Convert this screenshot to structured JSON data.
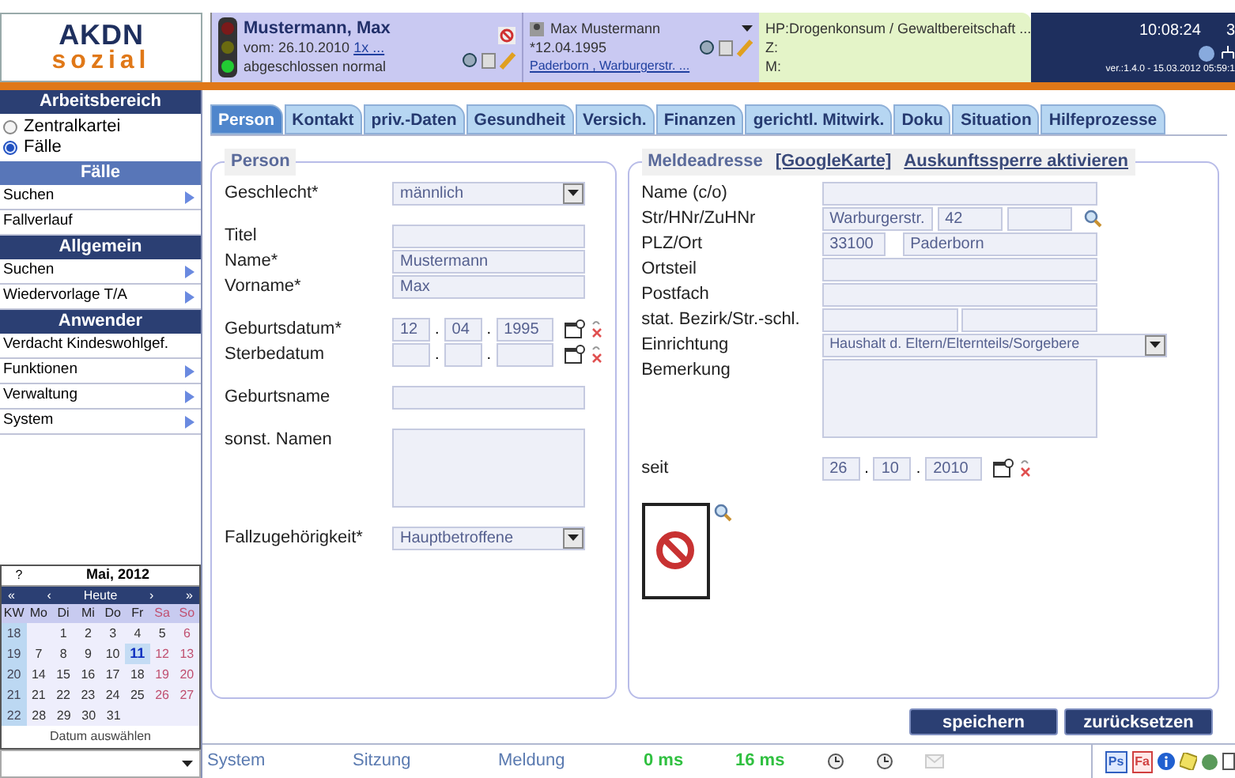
{
  "header": {
    "logo": {
      "line1": "AKDN",
      "line2": "sozial"
    },
    "case": {
      "name": "Mustermann, Max",
      "date": "vom: 26.10.2010",
      "link": "1x ...",
      "status": "abgeschlossen normal"
    },
    "person": {
      "name": "Max Mustermann",
      "birth": "*12.04.1995",
      "address": "Paderborn , Warburgerstr. ..."
    },
    "notes": [
      "HP:Drogenkonsum / Gewaltbereitschaft ...",
      "Z:",
      "M:"
    ],
    "clock": "10:08:24",
    "counter": "3",
    "version": "ver.:1.4.0 - 15.03.2012 05:59:1"
  },
  "sidebar": {
    "title": "Arbeitsbereich",
    "radios": [
      {
        "label": "Zentralkartei",
        "selected": false
      },
      {
        "label": "Fälle",
        "selected": true
      }
    ],
    "sections": [
      {
        "title": "Fälle",
        "items": [
          {
            "label": "Suchen",
            "submenu": true
          },
          {
            "label": "Fallverlauf",
            "submenu": false
          }
        ]
      },
      {
        "title": "Allgemein",
        "items": [
          {
            "label": "Suchen",
            "submenu": true
          },
          {
            "label": "Wiedervorlage T/A",
            "submenu": true
          }
        ]
      },
      {
        "title": "Anwender",
        "items": [
          {
            "label": "Verdacht Kindeswohlgef.",
            "submenu": false
          },
          {
            "label": "Funktionen",
            "submenu": true
          },
          {
            "label": "Verwaltung",
            "submenu": true
          },
          {
            "label": "System",
            "submenu": true
          }
        ]
      }
    ],
    "calendar": {
      "help": "?",
      "title": "Mai, 2012",
      "nav": [
        "«",
        "‹",
        "Heute",
        "›",
        "»"
      ],
      "columns": [
        "KW",
        "Mo",
        "Di",
        "Mi",
        "Do",
        "Fr",
        "Sa",
        "So"
      ],
      "weeks": [
        {
          "kw": "18",
          "days": [
            {
              "label": "1",
              "selected": false
            },
            {
              "label": "2",
              "selected": false
            },
            {
              "label": "3",
              "selected": false
            },
            {
              "label": "4",
              "selected": false
            },
            {
              "label": "5",
              "selected": false
            },
            {
              "label": "6",
              "selected": false
            }
          ]
        },
        {
          "kw": "19",
          "days": [
            {
              "label": "7",
              "selected": false
            },
            {
              "label": "8",
              "selected": false
            },
            {
              "label": "9",
              "selected": false
            },
            {
              "label": "10",
              "selected": false
            },
            {
              "label": "11",
              "selected": true
            },
            {
              "label": "12",
              "selected": false
            },
            {
              "label": "13",
              "selected": false
            }
          ]
        },
        {
          "kw": "20",
          "days": [
            {
              "label": "14",
              "selected": false
            },
            {
              "label": "15",
              "selected": false
            },
            {
              "label": "16",
              "selected": false
            },
            {
              "label": "17",
              "selected": false
            },
            {
              "label": "18",
              "selected": false
            },
            {
              "label": "19",
              "selected": false
            },
            {
              "label": "20",
              "selected": false
            }
          ]
        },
        {
          "kw": "21",
          "days": [
            {
              "label": "21",
              "selected": false
            },
            {
              "label": "22",
              "selected": false
            },
            {
              "label": "23",
              "selected": false
            },
            {
              "label": "24",
              "selected": false
            },
            {
              "label": "25",
              "selected": false
            },
            {
              "label": "26",
              "selected": false
            },
            {
              "label": "27",
              "selected": false
            }
          ]
        },
        {
          "kw": "22",
          "days": [
            {
              "label": "28",
              "selected": false
            },
            {
              "label": "29",
              "selected": false
            },
            {
              "label": "30",
              "selected": false
            },
            {
              "label": "31",
              "selected": false
            }
          ]
        }
      ],
      "footer": "Datum auswählen"
    }
  },
  "tabs": [
    {
      "label": "Person",
      "selected": true
    },
    {
      "label": "Kontakt",
      "selected": false
    },
    {
      "label": "priv.-Daten",
      "selected": false
    },
    {
      "label": "Gesundheit",
      "selected": false
    },
    {
      "label": "Versich.",
      "selected": false
    },
    {
      "label": "Finanzen",
      "selected": false
    },
    {
      "label": "gerichtl. Mitwirk.",
      "selected": false
    },
    {
      "label": "Doku",
      "selected": false
    },
    {
      "label": "Situation",
      "selected": false
    },
    {
      "label": "Hilfeprozesse",
      "selected": false
    }
  ],
  "person": {
    "legend": "Person",
    "groups": [
      {
        "rows": [
          {
            "label": "Geschlecht*",
            "kind": "select",
            "parts": [
              "männlich"
            ]
          }
        ]
      },
      {
        "rows": [
          {
            "label": "Titel",
            "kind": "text"
          },
          {
            "label": "Name*",
            "kind": "text",
            "parts": [
              "Mustermann"
            ]
          },
          {
            "label": "Vorname*",
            "kind": "text",
            "parts": [
              "Max"
            ]
          }
        ]
      },
      {
        "rows": [
          {
            "label": "Geburtsdatum*",
            "kind": "date",
            "separators": [
              ".",
              "."
            ],
            "parts": [
              "12",
              "04",
              "1995"
            ]
          },
          {
            "label": "Sterbedatum",
            "kind": "date",
            "separators": [
              ".",
              "."
            ]
          }
        ]
      },
      {
        "rows": [
          {
            "label": "Geburtsname",
            "kind": "text"
          }
        ]
      },
      {
        "rows": [
          {
            "label": "sonst. Namen",
            "kind": "textarea"
          }
        ]
      },
      {
        "rows": [
          {
            "label": "Fallzugehörigkeit*",
            "kind": "select",
            "parts": [
              "Hauptbetroffene"
            ]
          }
        ]
      }
    ]
  },
  "address": {
    "legend": "Meldeadresse",
    "links": [
      "[GoogleKarte]",
      "Auskunftssperre aktivieren"
    ],
    "groups": [
      {
        "rows": [
          {
            "label": "Name (c/o)",
            "kind": "text"
          },
          {
            "label": "Str/HNr/ZuHNr",
            "kind": "street",
            "parts": [
              "Warburgerstr.",
              "42"
            ]
          },
          {
            "label": "PLZ/Ort",
            "kind": "plz",
            "parts": [
              "33100",
              "Paderborn"
            ]
          },
          {
            "label": "Ortsteil",
            "kind": "text"
          },
          {
            "label": "Postfach",
            "kind": "text"
          },
          {
            "label": "stat. Bezirk/Str.-schl.",
            "kind": "pair"
          },
          {
            "label": "Einrichtung",
            "kind": "select",
            "parts": [
              "Haushalt d. Eltern/Elternteils/Sorgebere"
            ]
          },
          {
            "label": "Bemerkung",
            "kind": "textarea"
          }
        ]
      },
      {
        "rows": [
          {
            "label": "seit",
            "kind": "date",
            "separators": [
              ".",
              "."
            ],
            "parts": [
              "26",
              "10",
              "2010"
            ]
          }
        ]
      }
    ]
  },
  "buttons": [
    "speichern",
    "zurücksetzen"
  ],
  "status": {
    "fields": [
      "System",
      "Sitzung",
      "Meldung"
    ],
    "timings": [
      "0 ms",
      "16 ms"
    ],
    "badges": [
      "Ps",
      "Fa"
    ]
  }
}
